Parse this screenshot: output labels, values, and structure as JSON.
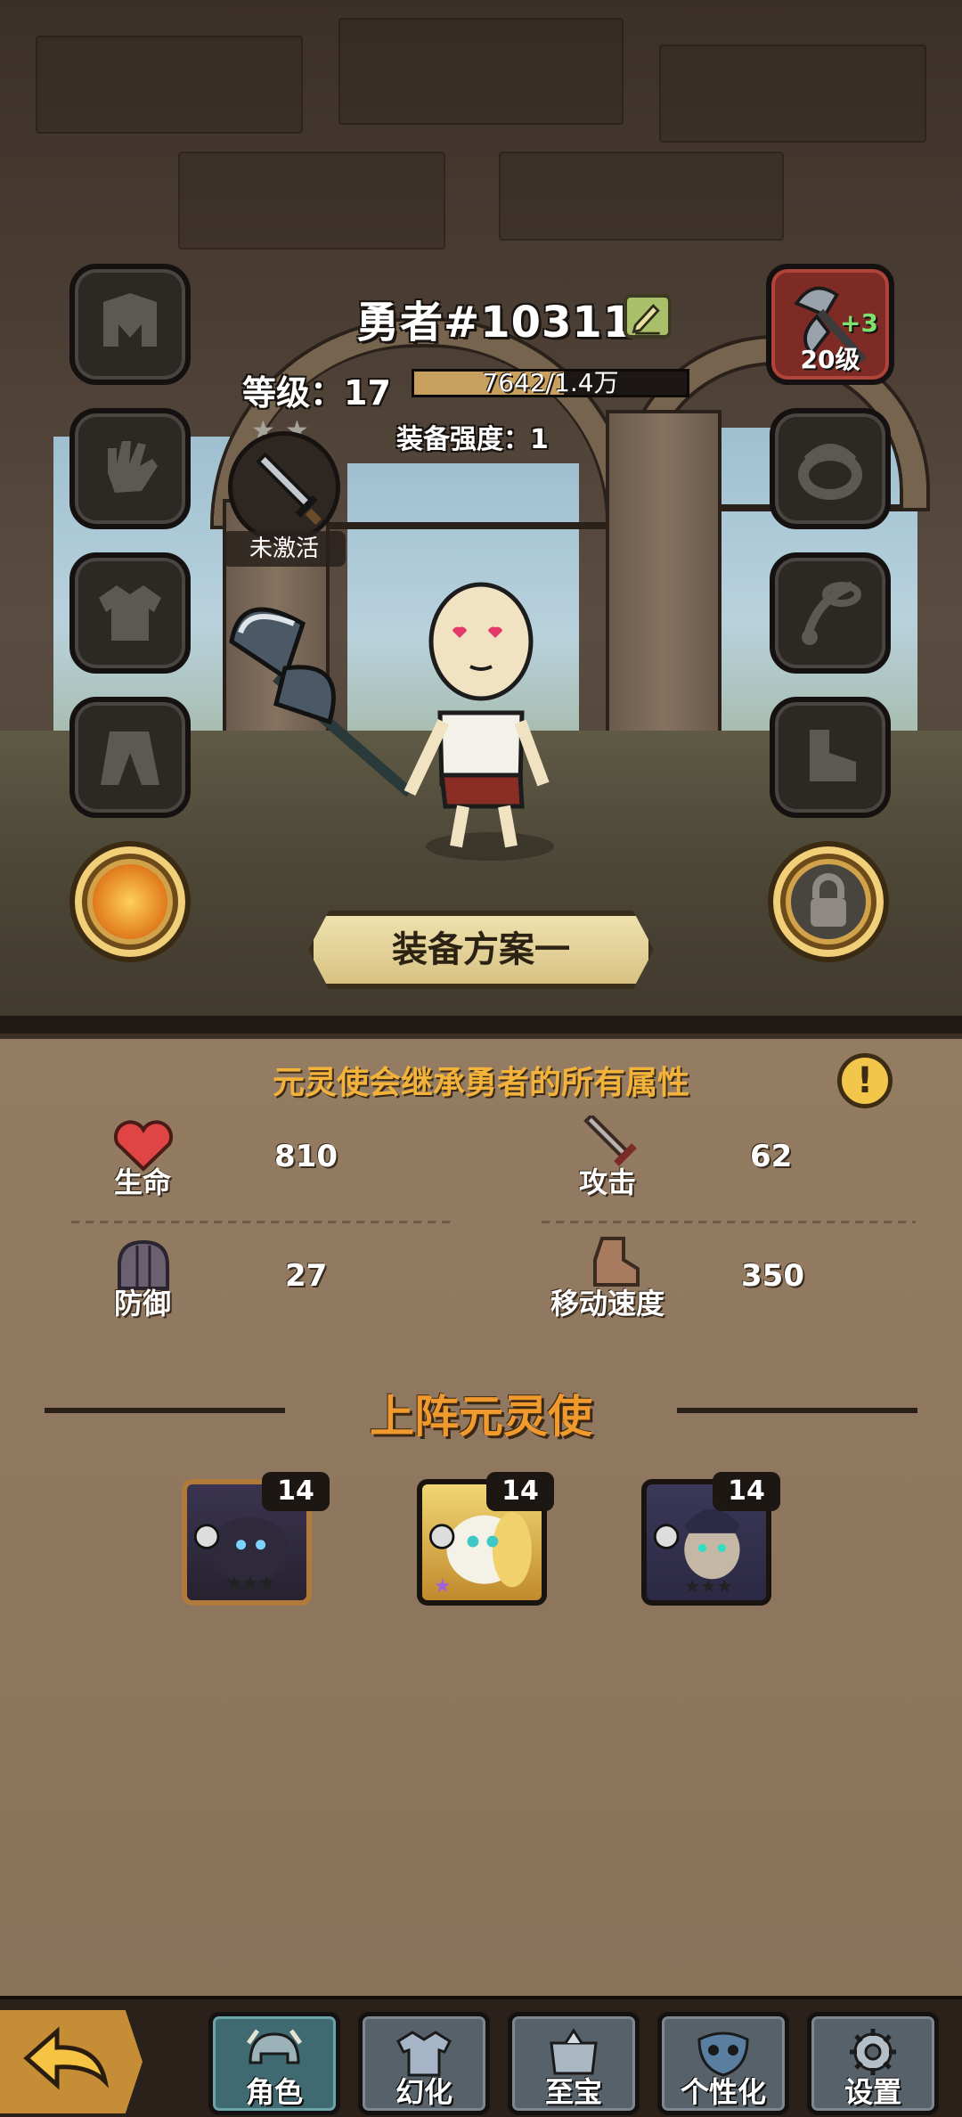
{
  "hero": {
    "name": "勇者#10311",
    "level_label": "等级：17",
    "xp_text": "7642/1.4万",
    "xp_fraction": 0.55,
    "power_label": "装备强度：1",
    "skill_status": "未激活"
  },
  "weapon": {
    "plus": "+3",
    "level": "20级"
  },
  "plan_button": "装备方案一",
  "panel": {
    "hint": "元灵使会继承勇者的所有属性",
    "info": "!",
    "stats": [
      {
        "label": "生命",
        "value": "810"
      },
      {
        "label": "攻击",
        "value": "62"
      },
      {
        "label": "防御",
        "value": "27"
      },
      {
        "label": "移动速度",
        "value": "350"
      }
    ],
    "section_title": "上阵元灵使",
    "spirits": [
      {
        "level": "14",
        "color": "#6a2f2a"
      },
      {
        "level": "14",
        "color": "#b7742d"
      },
      {
        "level": "14",
        "color": "#b7742d"
      }
    ]
  },
  "nav": {
    "tabs": [
      {
        "label": "角色",
        "icon": "helmet-icon",
        "active": true
      },
      {
        "label": "幻化",
        "icon": "armor-icon",
        "active": false
      },
      {
        "label": "至宝",
        "icon": "treasure-icon",
        "active": false
      },
      {
        "label": "个性化",
        "icon": "mask-icon",
        "active": false
      },
      {
        "label": "设置",
        "icon": "gear-icon",
        "active": false
      }
    ]
  },
  "colors": {
    "accent_orange": "#f09a2e",
    "hint_gold": "#f3b23a",
    "xp_fill": "#c8a05d"
  }
}
